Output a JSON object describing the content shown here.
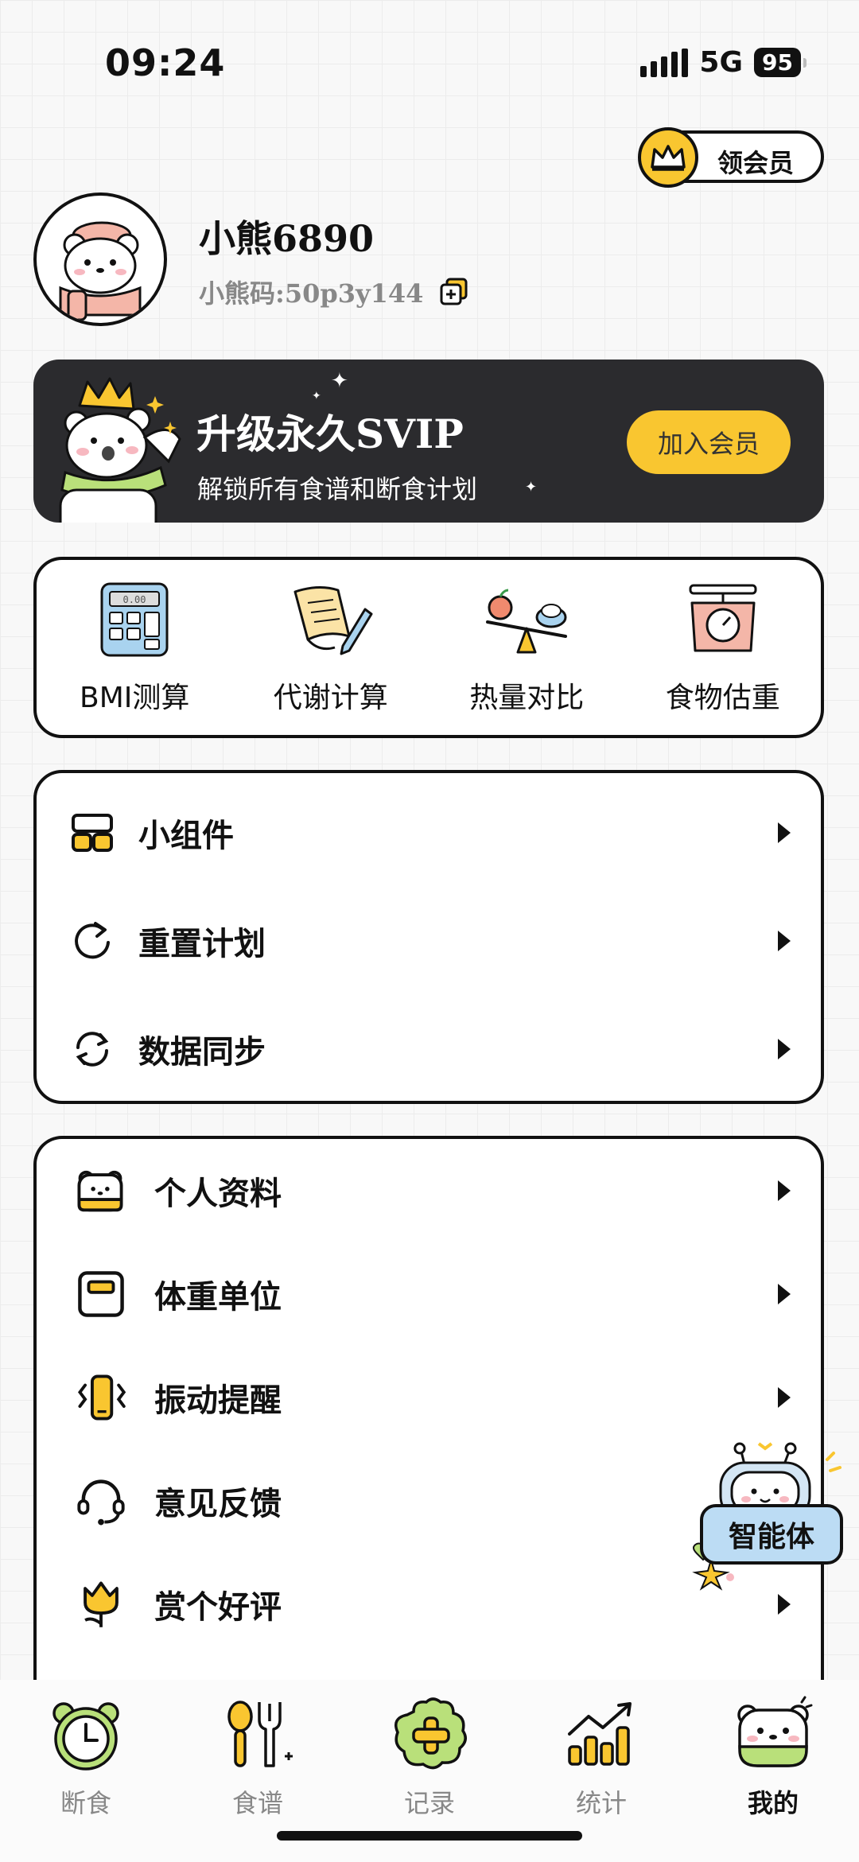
{
  "status_bar": {
    "time": "09:24",
    "network": "5G",
    "battery": "95"
  },
  "header": {
    "vip_pill_label": "领会员"
  },
  "profile": {
    "username": "小熊6890",
    "code": "小熊码:50p3y144"
  },
  "svip_banner": {
    "title": "升级永久SVIP",
    "subtitle": "解锁所有食谱和断食计划",
    "button": "加入会员"
  },
  "tools": [
    {
      "label": "BMI测算",
      "icon": "calculator-icon"
    },
    {
      "label": "代谢计算",
      "icon": "document-pen-icon"
    },
    {
      "label": "热量对比",
      "icon": "scale-balance-icon"
    },
    {
      "label": "食物估重",
      "icon": "kitchen-scale-icon"
    }
  ],
  "menu_group_1": [
    {
      "label": "小组件",
      "icon": "widget-icon"
    },
    {
      "label": "重置计划",
      "icon": "reset-icon"
    },
    {
      "label": "数据同步",
      "icon": "sync-icon"
    }
  ],
  "menu_group_2": [
    {
      "label": "个人资料",
      "icon": "bear-profile-icon"
    },
    {
      "label": "体重单位",
      "icon": "scale-unit-icon"
    },
    {
      "label": "振动提醒",
      "icon": "vibrate-icon"
    },
    {
      "label": "意见反馈",
      "icon": "headset-icon"
    },
    {
      "label": "赏个好评",
      "icon": "tulip-icon"
    }
  ],
  "agent": {
    "label": "智能体"
  },
  "tabbar": [
    {
      "label": "断食",
      "icon": "clock-icon",
      "active": false
    },
    {
      "label": "食谱",
      "icon": "utensils-icon",
      "active": false
    },
    {
      "label": "记录",
      "icon": "add-record-icon",
      "active": false
    },
    {
      "label": "统计",
      "icon": "chart-icon",
      "active": false
    },
    {
      "label": "我的",
      "icon": "bear-face-icon",
      "active": true
    }
  ],
  "colors": {
    "accent_yellow": "#f9c630",
    "banner_dark": "#2b2b2e",
    "agent_blue": "#bcdcf4",
    "green": "#b9e07a"
  }
}
